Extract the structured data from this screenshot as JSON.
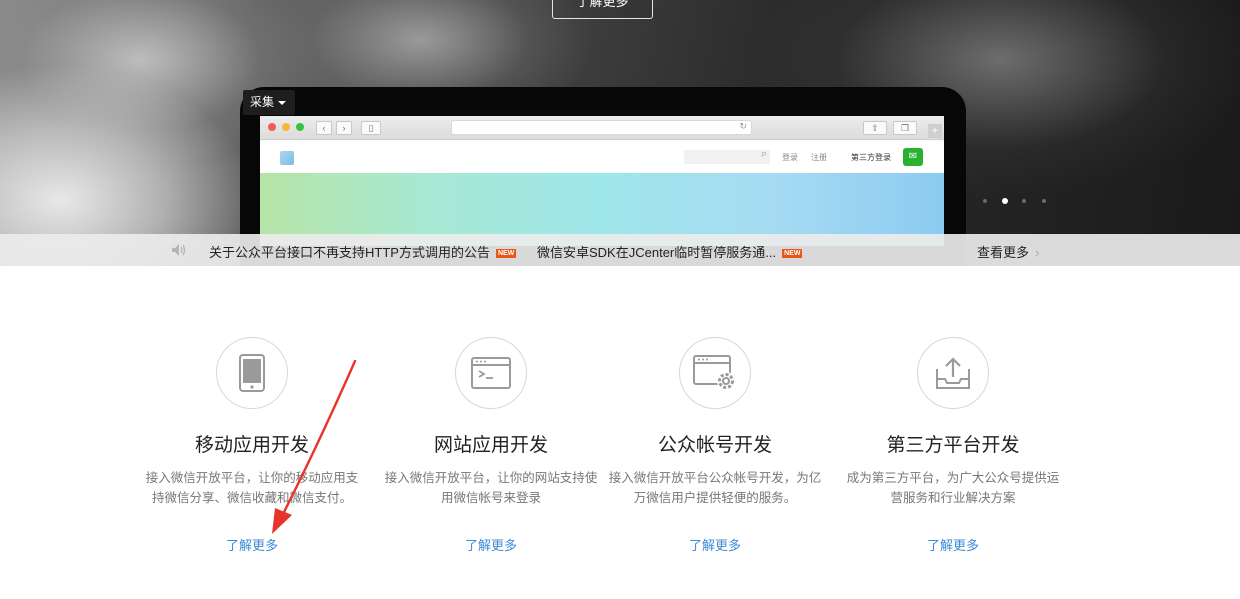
{
  "hero": {
    "button_label": "了解更多",
    "collect_label": "采集",
    "mockup": {
      "site_links": [
        "登录",
        "注册"
      ],
      "third_party_label": "第三方登录"
    }
  },
  "notice": {
    "items": [
      {
        "text": "关于公众平台接口不再支持HTTP方式调用的公告",
        "badge": "NEW"
      },
      {
        "text": "微信安卓SDK在JCenter临时暂停服务通...",
        "badge": "NEW"
      }
    ],
    "more_label": "查看更多"
  },
  "features": [
    {
      "title": "移动应用开发",
      "desc": "接入微信开放平台，让你的移动应用支持微信分享、微信收藏和微信支付。",
      "more": "了解更多",
      "icon": "mobile-phone-icon"
    },
    {
      "title": "网站应用开发",
      "desc": "接入微信开放平台，让你的网站支持使用微信帐号来登录",
      "more": "了解更多",
      "icon": "terminal-window-icon"
    },
    {
      "title": "公众帐号开发",
      "desc": "接入微信开放平台公众帐号开发，为亿万微信用户提供轻便的服务。",
      "more": "了解更多",
      "icon": "window-gear-icon"
    },
    {
      "title": "第三方平台开发",
      "desc": "成为第三方平台，为广大公众号提供运营服务和行业解决方案",
      "more": "了解更多",
      "icon": "upload-tray-icon"
    }
  ],
  "colors": {
    "link": "#3c8ad8",
    "new_badge": "#e8561a",
    "annotation_arrow": "#e8332a"
  }
}
